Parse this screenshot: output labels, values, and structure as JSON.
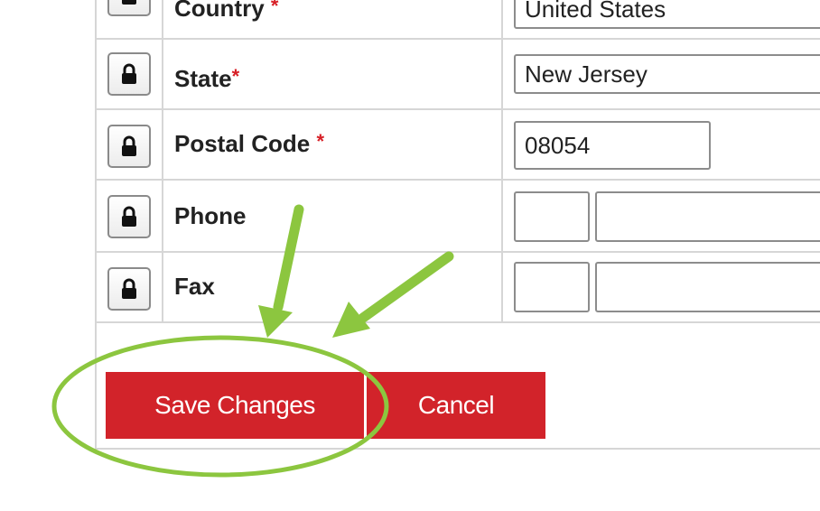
{
  "form": {
    "rows": [
      {
        "label": "Country",
        "required_mark": "*",
        "value": "United States"
      },
      {
        "label": "State",
        "required_mark": "*",
        "value": "New Jersey"
      },
      {
        "label": "Postal Code",
        "required_mark": "*",
        "value": "08054"
      },
      {
        "label": "Phone",
        "required_mark": "",
        "value": ""
      },
      {
        "label": "Fax",
        "required_mark": "",
        "value": ""
      }
    ]
  },
  "actions": {
    "save_label": "Save Changes",
    "cancel_label": "Cancel"
  },
  "colors": {
    "button_red": "#d2232a",
    "required_red": "#d71f26",
    "annotation_green": "#8cc63f"
  },
  "icons": [
    "lock-icon",
    "annotation-arrow",
    "annotation-ellipse"
  ]
}
